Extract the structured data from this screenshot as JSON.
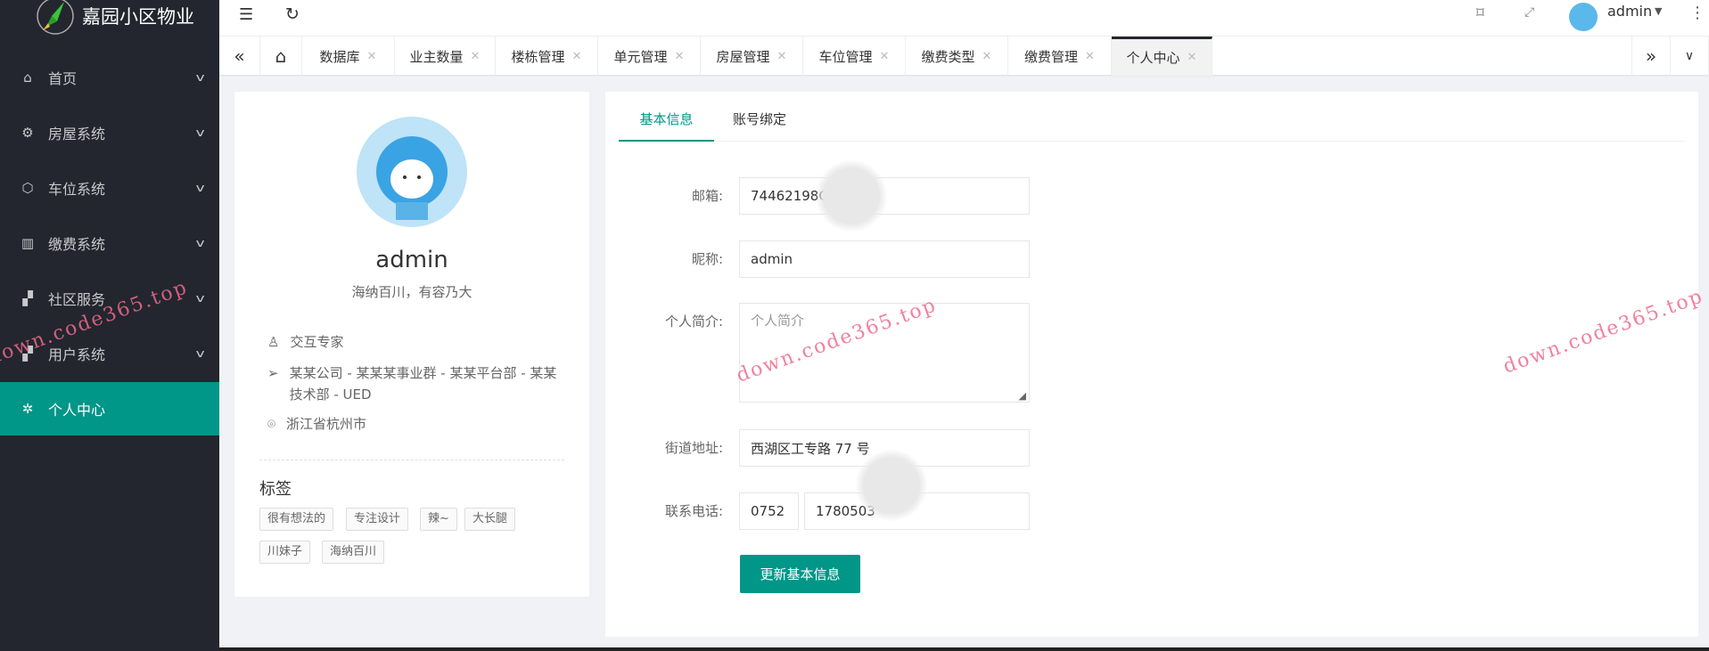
{
  "app": {
    "title": "嘉园小区物业"
  },
  "sidebar": {
    "items": [
      {
        "label": "首页",
        "icon": "home-icon"
      },
      {
        "label": "房屋系统",
        "icon": "gear-icon"
      },
      {
        "label": "车位系统",
        "icon": "cube-icon"
      },
      {
        "label": "缴费系统",
        "icon": "book-icon"
      },
      {
        "label": "社区服务",
        "icon": "apps-icon"
      },
      {
        "label": "用户系统",
        "icon": "apps-icon"
      },
      {
        "label": "个人中心",
        "icon": "settings-icon",
        "active": true
      }
    ]
  },
  "header": {
    "username": "admin"
  },
  "tabs": [
    "数据库",
    "业主数量",
    "楼栋管理",
    "单元管理",
    "房屋管理",
    "车位管理",
    "缴费类型",
    "缴费管理",
    "个人中心"
  ],
  "profile": {
    "name": "admin",
    "motto": "海纳百川，有容乃大",
    "title": "交互专家",
    "org": "某某公司 - 某某某事业群 - 某某平台部 - 某某技术部 - UED",
    "location": "浙江省杭州市",
    "tags_heading": "标签",
    "tags": [
      "很有想法的",
      "专注设计",
      "辣~",
      "大长腿",
      "川妹子",
      "海纳百川"
    ]
  },
  "form": {
    "tabs": [
      "基本信息",
      "账号绑定"
    ],
    "email_label": "邮箱:",
    "email": "74462198C",
    "nickname_label": "昵称:",
    "nickname": "admin",
    "bio_label": "个人简介:",
    "bio_placeholder": "个人简介",
    "address_label": "街道地址:",
    "address": "西湖区工专路 77 号",
    "phone_label": "联系电话:",
    "area_code": "0752",
    "phone": "1780503",
    "submit": "更新基本信息"
  },
  "watermark": "down.code365.top",
  "colors": {
    "accent": "#009688",
    "sidebar": "#23262e"
  }
}
